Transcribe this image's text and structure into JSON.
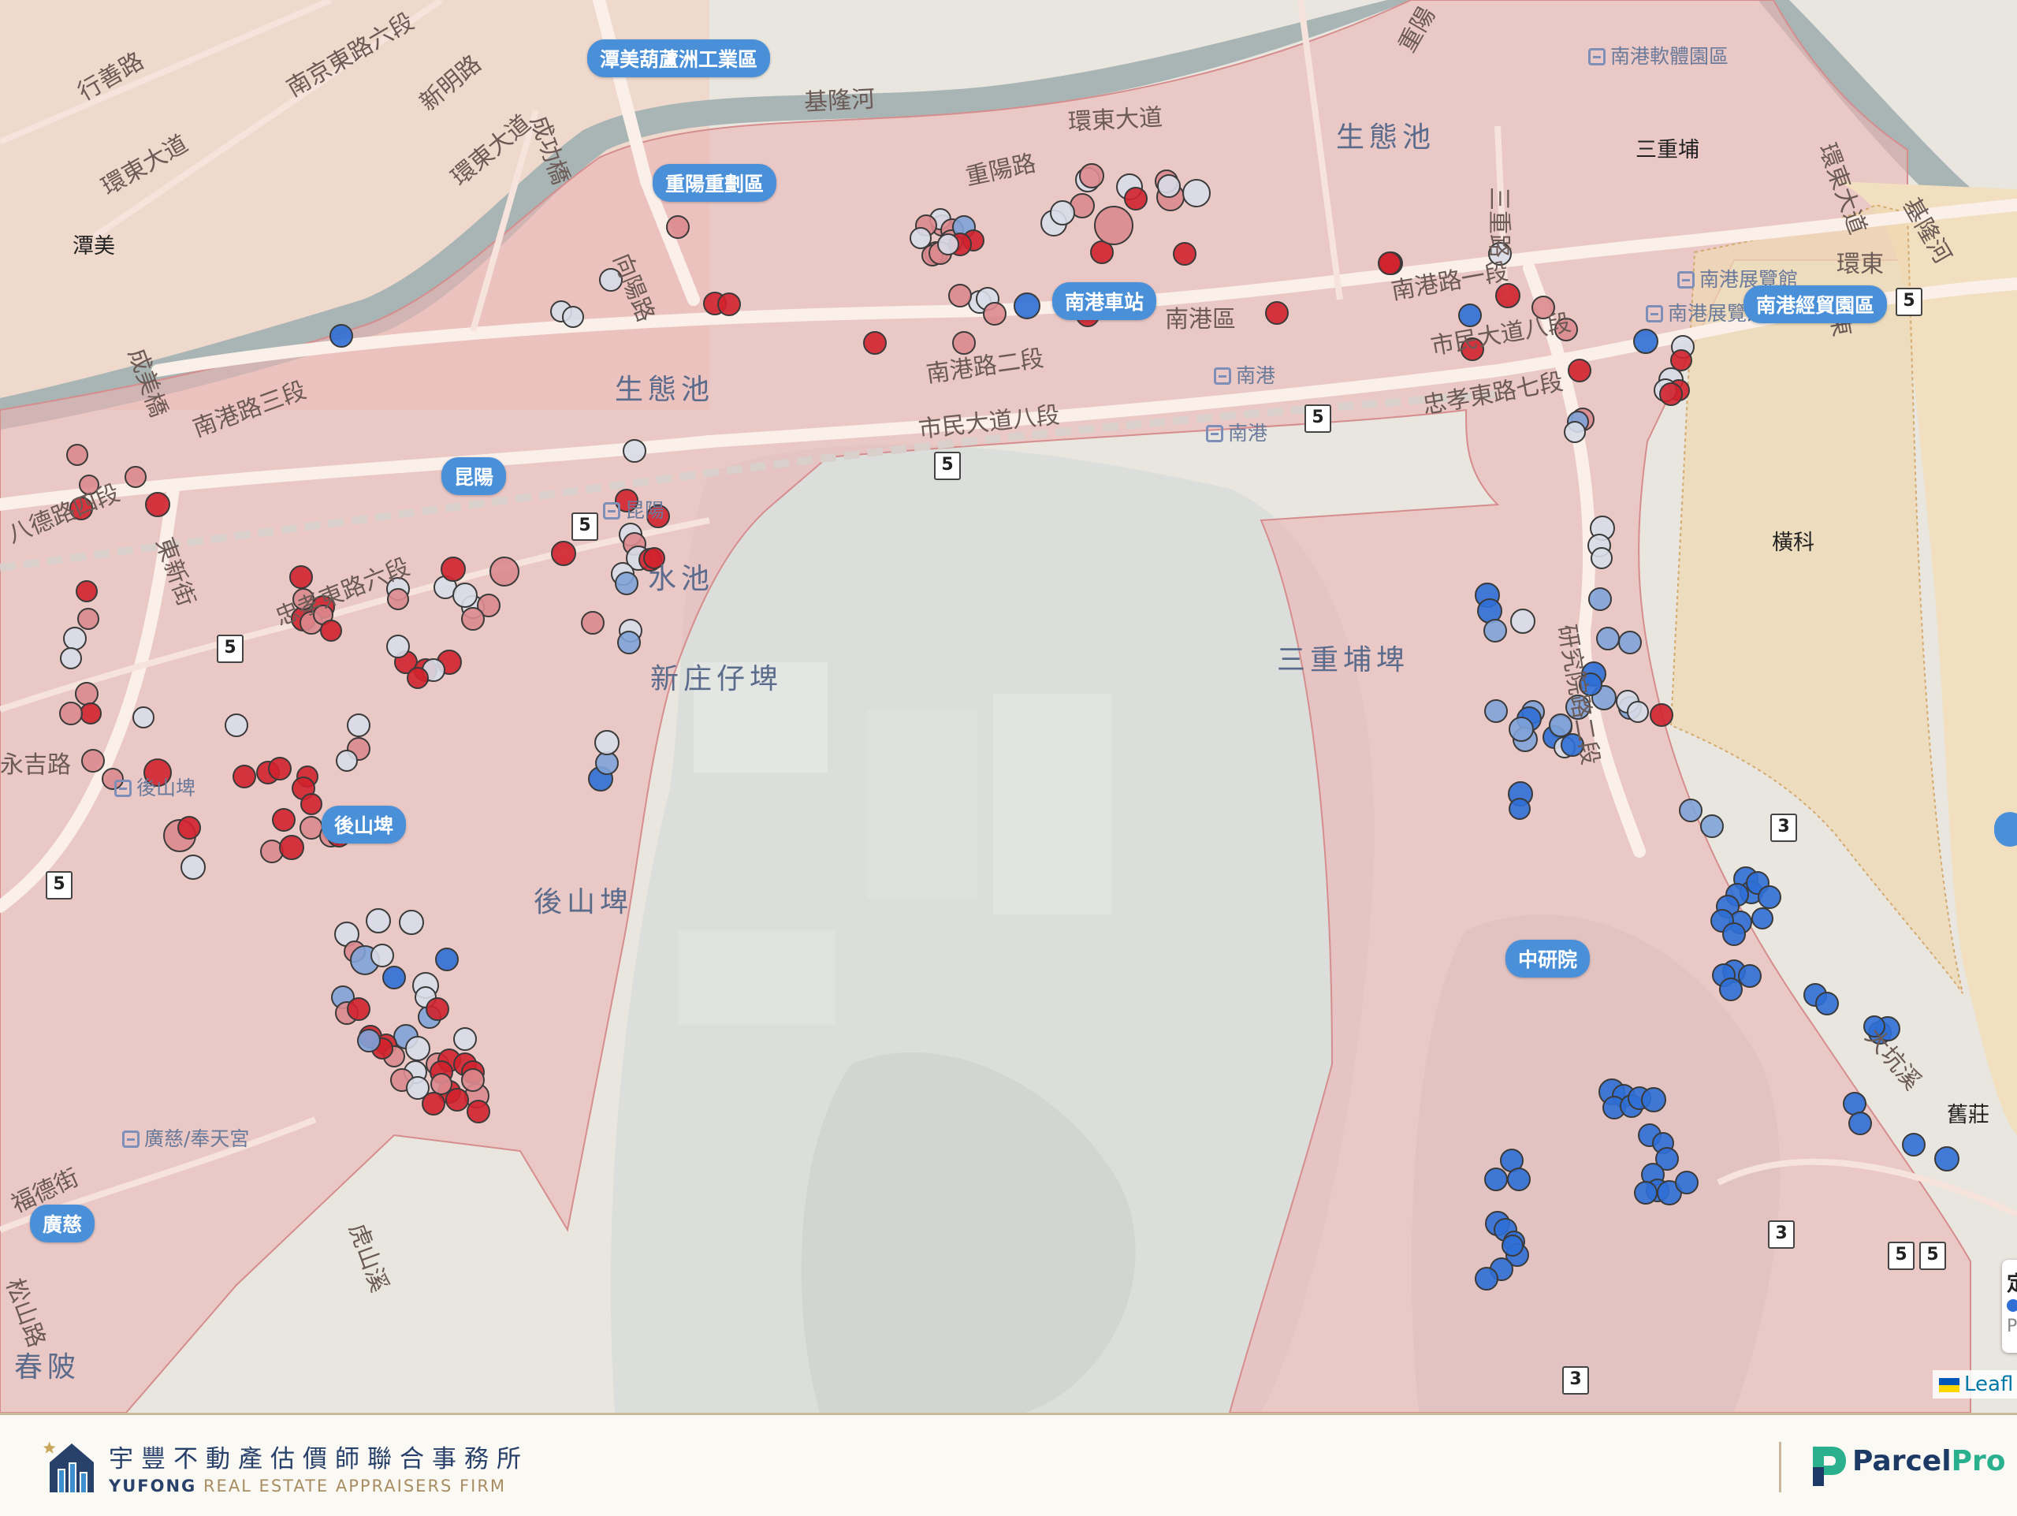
{
  "map": {
    "district_labels": [
      "生態池",
      "生態池",
      "水池",
      "新庄仔埤",
      "後山埤",
      "三重埔埤",
      "春陂"
    ],
    "place_labels": [
      "潭美",
      "三重埔",
      "橫科",
      "舊莊"
    ],
    "road_labels": [
      "行善路",
      "南京東路六段",
      "新明路",
      "環東大道",
      "成功橋",
      "基隆河",
      "環東大道",
      "重陽路",
      "向陽路",
      "環東大道",
      "南港路三段",
      "南港路二段",
      "市民大道八段",
      "南港路一段",
      "市民大道八段",
      "忠孝東路七段",
      "忠孝東路六段",
      "八德路四段",
      "東新街",
      "永吉路",
      "福德街",
      "研究院路二段",
      "三重路",
      "成美橋",
      "環東大道",
      "基隆河",
      "環東",
      "虎山溪",
      "大坑溪",
      "松山路",
      "環東",
      "重陽",
      "南港區"
    ],
    "station_labels": [
      "南港軟體園區",
      "南港展覽館",
      "南港展覽館",
      "南港",
      "南港",
      "昆陽",
      "廣慈/奉天宮",
      "後山埤"
    ],
    "area_pills": [
      "潭美葫蘆洲工業區",
      "重陽重劃區",
      "南港車站",
      "南港經貿園區",
      "昆陽",
      "後山埤",
      "中研院",
      "廣慈"
    ],
    "highway_shields": [
      "5",
      "5",
      "5",
      "5",
      "5",
      "5",
      "5",
      "3",
      "3",
      "3",
      "5"
    ],
    "legend": {
      "title": "定",
      "label": "P"
    },
    "attribution": "Leafl"
  },
  "footer": {
    "company_name": "宇豐不動產估價師聯合事務所",
    "company_en_bold": "YUFONG",
    "company_en_light": " REAL ESTATE APPRAISERS FIRM",
    "brand_parcel": "Parcel",
    "brand_pro": "Pro"
  },
  "colors": {
    "high": "#d0222e",
    "mid_red": "#dc8a8e",
    "neutral": "#d8dde8",
    "mid_blue": "#7fa3d9",
    "low": "#2f6fd6"
  }
}
